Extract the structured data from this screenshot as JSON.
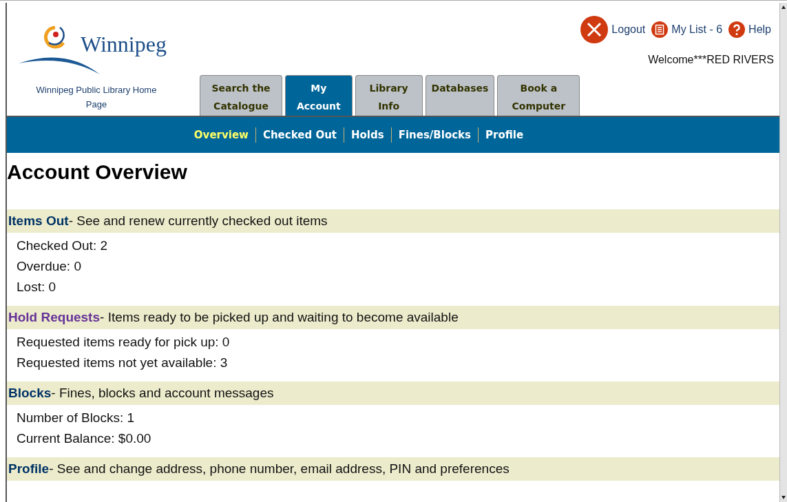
{
  "logo": {
    "wordmark": "Winnipeg",
    "caption": "Winnipeg Public Library Home Page"
  },
  "top_links": [
    {
      "kind": "logout",
      "label": "Logout"
    },
    {
      "kind": "list",
      "label": "My List - 6"
    },
    {
      "kind": "help",
      "label": "Help"
    }
  ],
  "welcome": "Welcome***RED RIVERS",
  "tabs": [
    {
      "label": "Search the Catalogue",
      "selected": false
    },
    {
      "label": "My Account",
      "selected": true
    },
    {
      "label": "Library Info",
      "selected": false
    },
    {
      "label": "Databases",
      "selected": false
    },
    {
      "label": "Book a Computer",
      "selected": false
    }
  ],
  "subnav": [
    {
      "label": "Overview",
      "selected": true
    },
    {
      "label": "Checked Out",
      "selected": false
    },
    {
      "label": "Holds",
      "selected": false
    },
    {
      "label": "Fines/Blocks",
      "selected": false
    },
    {
      "label": "Profile",
      "selected": false
    }
  ],
  "title": "Account Overview",
  "sections": [
    {
      "link": "Items Out",
      "color": "#003366",
      "description": "- See and renew currently checked out items",
      "lines": [
        "Checked Out: 2",
        "Overdue: 0",
        "Lost: 0"
      ]
    },
    {
      "link": "Hold Requests",
      "color": "#663399",
      "description": "- Items ready to be picked up and waiting to become available",
      "lines": [
        "Requested items ready for pick up: 0",
        "Requested items not yet available: 3"
      ]
    },
    {
      "link": "Blocks",
      "color": "#003366",
      "description": "- Fines, blocks and account messages",
      "lines": [
        "Number of Blocks: 1",
        "Current Balance: $0.00"
      ]
    },
    {
      "link": "Profile",
      "color": "#003366",
      "description": "- See and change address, phone number, email address, PIN and preferences"
    }
  ]
}
